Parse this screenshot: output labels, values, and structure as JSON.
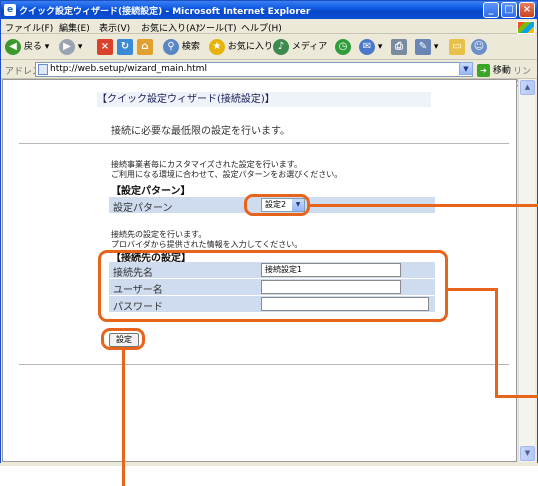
{
  "window": {
    "title": "クイック設定ウィザード(接続設定) - Microsoft Internet Explorer",
    "controls": [
      "_",
      "□",
      "×"
    ]
  },
  "menu": {
    "items": [
      "ファイル(F)",
      "編集(E)",
      "表示(V)",
      "お気に入り(A)",
      "ツール(T)",
      "ヘルプ(H)"
    ]
  },
  "toolbar": {
    "back_label": "戻る",
    "search_label": "検索",
    "favorites_label": "お気に入り",
    "media_label": "メディア"
  },
  "address": {
    "label": "アドレス(D)",
    "url": "http://web.setup/wizard_main.html",
    "go_label": "移動",
    "links_label": "リンク"
  },
  "page": {
    "title": "【クイック設定ウィザード(接続設定)】",
    "intro": "接続に必要な最低限の設定を行います。",
    "pattern_desc_1": "接続事業者毎にカスタマイズされた設定を行います。",
    "pattern_desc_2": "ご利用になる環境に合わせて、設定パターンをお選びください。",
    "pattern_section_title": "【設定パターン】",
    "pattern_label": "設定パターン",
    "pattern_selected": "設定2",
    "conn_desc_1": "接続先の設定を行います。",
    "conn_desc_2": "プロバイダから提供された情報を入力してください。",
    "conn_section_title": "【接続先の設定】",
    "fields": [
      {
        "label": "接続先名",
        "value": "接続設定1"
      },
      {
        "label": "ユーザー名",
        "value": ""
      },
      {
        "label": "パスワード",
        "value": ""
      }
    ],
    "submit_label": "設定"
  },
  "colors": {
    "callout": "#e8641b",
    "row_bg": "#cfdcef",
    "titlebar": "#0a55e0"
  }
}
